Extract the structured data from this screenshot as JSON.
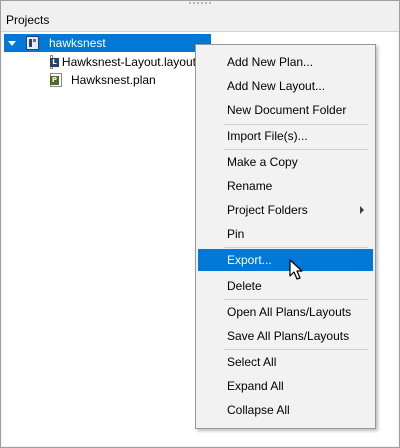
{
  "panel": {
    "title": "Projects"
  },
  "tree": {
    "project": {
      "label": "hawksnest",
      "icon": "project-icon"
    },
    "children": [
      {
        "label": "Hawksnest-Layout.layout",
        "badge": "L",
        "icon": "layout-file-icon"
      },
      {
        "label": "Hawksnest.plan",
        "badge": "P",
        "icon": "plan-file-icon"
      }
    ]
  },
  "context_menu": {
    "items": [
      {
        "label": "Add New Plan..."
      },
      {
        "label": "Add New Layout..."
      },
      {
        "label": "New Document Folder"
      },
      {
        "label": "Import File(s)..."
      },
      {
        "label": "Make a Copy"
      },
      {
        "label": "Rename"
      },
      {
        "label": "Project Folders",
        "submenu": true
      },
      {
        "label": "Pin"
      },
      {
        "label": "Export...",
        "highlighted": true
      },
      {
        "label": "Delete"
      },
      {
        "label": "Open All Plans/Layouts"
      },
      {
        "label": "Save All Plans/Layouts"
      },
      {
        "label": "Select All"
      },
      {
        "label": "Expand All"
      },
      {
        "label": "Collapse All"
      }
    ]
  },
  "colors": {
    "selection": "#0078d7",
    "menu_background": "#f2f2f2",
    "panel_background": "#f0f0f0"
  }
}
